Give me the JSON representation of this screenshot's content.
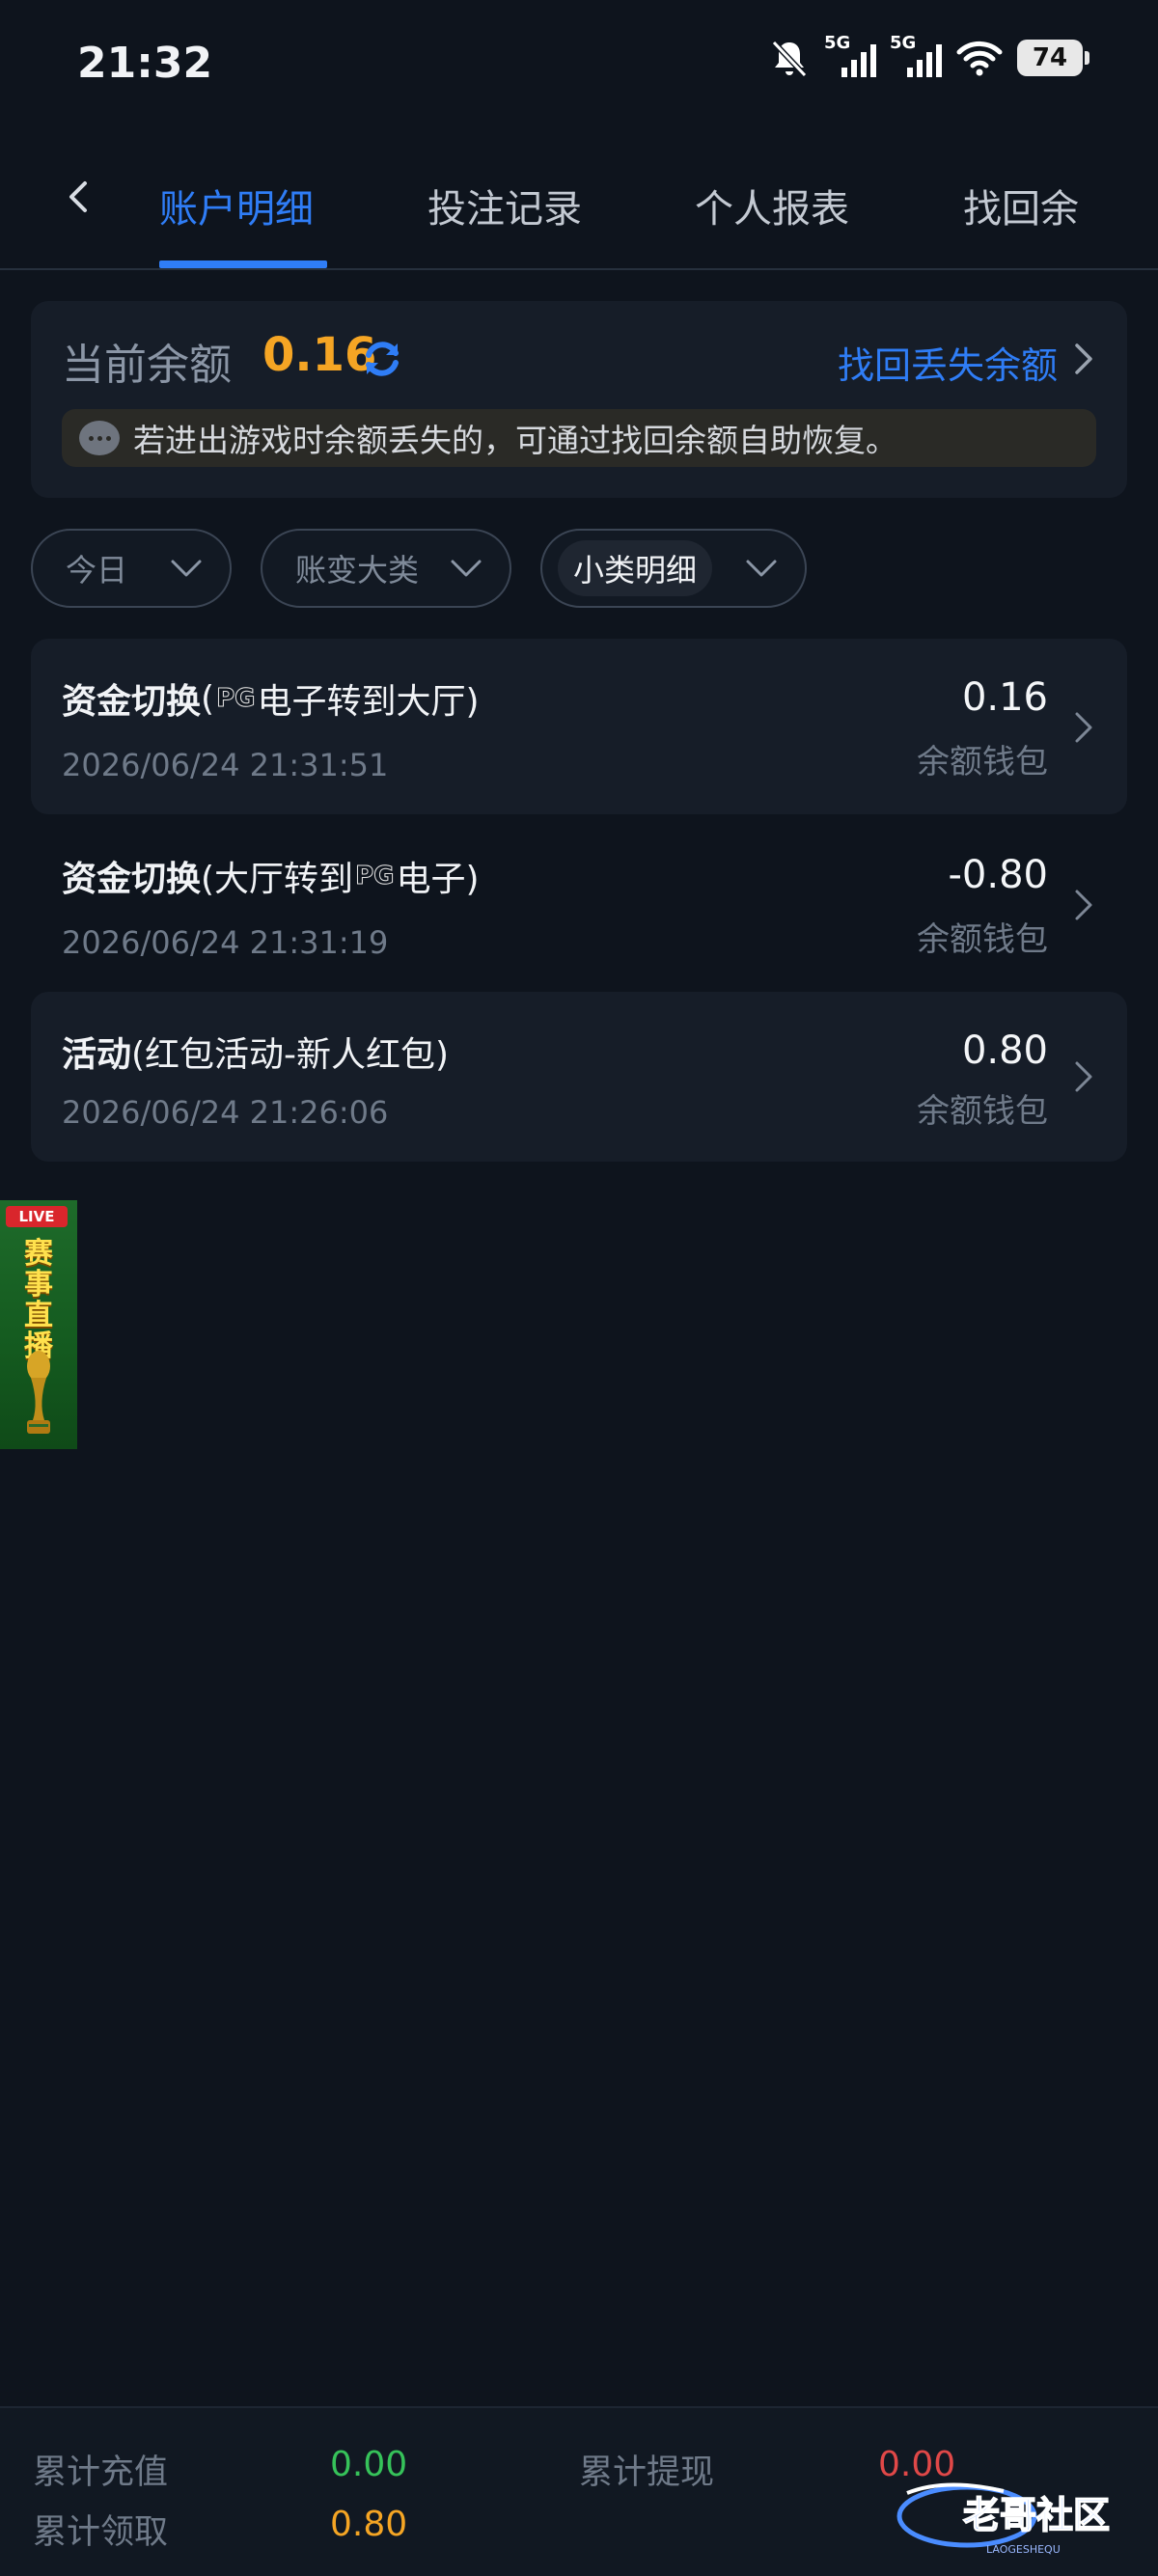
{
  "status_bar": {
    "time": "21:32",
    "signal1_label": "5G",
    "signal2_label": "5G",
    "battery": "74"
  },
  "tabs": [
    {
      "label": "账户明细",
      "active": true
    },
    {
      "label": "投注记录",
      "active": false
    },
    {
      "label": "个人报表",
      "active": false
    },
    {
      "label": "找回余",
      "active": false
    }
  ],
  "balance": {
    "label": "当前余额",
    "value": "0.16",
    "recover_link": "找回丢失余额",
    "notice": "若进出游戏时余额丢失的，可通过找回余额自助恢复。"
  },
  "filters": [
    {
      "label": "今日",
      "selected": false
    },
    {
      "label": "账变大类",
      "selected": false
    },
    {
      "label": "小类明细",
      "selected": true
    }
  ],
  "records": [
    {
      "title_main": "资金切换",
      "title_pre": " (",
      "title_logo": "PG",
      "title_post": "电子转到大厅)",
      "time": "2026/06/24 21:31:51",
      "amount": "0.16",
      "wallet": "余额钱包"
    },
    {
      "title_main": "资金切换",
      "title_pre": " (大厅转到",
      "title_logo": "PG",
      "title_post": "电子)",
      "time": "2026/06/24 21:31:19",
      "amount": "-0.80",
      "wallet": "余额钱包"
    },
    {
      "title_main": "活动",
      "title_pre": " (红包活动-新人红包)",
      "title_logo": "",
      "title_post": "",
      "time": "2026/06/24 21:26:06",
      "amount": "0.80",
      "wallet": "余额钱包"
    }
  ],
  "live_banner": {
    "tag": "LIVE",
    "chars": [
      "赛",
      "事",
      "直",
      "播"
    ]
  },
  "footer": {
    "total_recharge_label": "累计充值",
    "total_recharge_value": "0.00",
    "total_withdraw_label": "累计提现",
    "total_withdraw_value": "0.00",
    "total_claim_label": "累计领取",
    "total_claim_value": "0.80"
  },
  "watermark": {
    "text": "老哥社区",
    "subtext": "LAOGESHEQU"
  },
  "colors": {
    "accent": "#2f7df6",
    "balance": "#f5a524",
    "positive": "#36c25a",
    "negative": "#e04848",
    "background": "#0e141d"
  }
}
